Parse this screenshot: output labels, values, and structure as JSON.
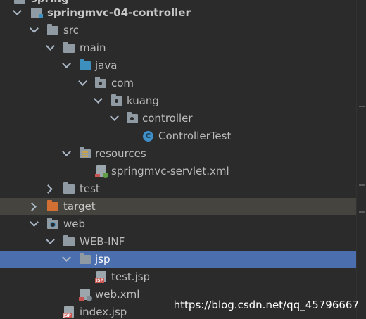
{
  "tree": {
    "partial_top_label": "spring",
    "project": "springmvc-04-controller",
    "src": "src",
    "main": "main",
    "java": "java",
    "com": "com",
    "kuang": "kuang",
    "controller": "controller",
    "controller_test": "ControllerTest",
    "controller_test_icon": "C",
    "resources": "resources",
    "servlet_xml": "springmvc-servlet.xml",
    "test": "test",
    "target": "target",
    "web": "web",
    "web_inf": "WEB-INF",
    "jsp": "jsp",
    "test_jsp": "test.jsp",
    "web_xml": "web.xml",
    "index_jsp": "index.jsp",
    "jsp_badge": "JSP"
  },
  "watermark": "https://blog.csdn.net/qq_45796667",
  "colors": {
    "background": "#2b2b2b",
    "selected": "#4b6eaf",
    "excluded": "#45443e",
    "source_folder": "#3d8fbd",
    "excluded_folder": "#d26f33"
  }
}
